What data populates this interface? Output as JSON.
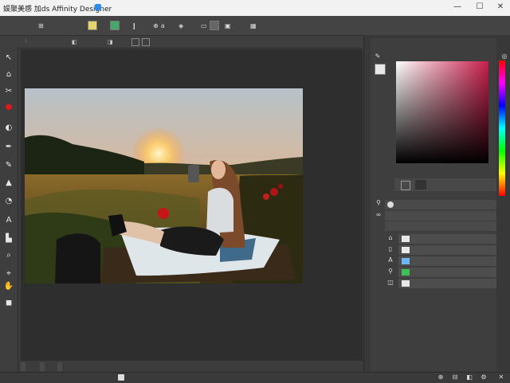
{
  "app": {
    "title": "娱聚美感 加ds Affinity Designer",
    "title_suffix_icon": "app-badge-icon"
  },
  "window_controls": {
    "minimize": "—",
    "maximize": "☐",
    "close": "✕"
  },
  "toolbar": {
    "items": [
      {
        "icon": "",
        "label": ""
      },
      {
        "icon": "⊞",
        "label": ""
      },
      {
        "icon": "",
        "label": ""
      },
      {
        "icon": "⊡",
        "label": ""
      },
      {
        "icon": "❙",
        "label": ""
      },
      {
        "icon": "⊕",
        "label": "a"
      },
      {
        "icon": "◈",
        "label": ""
      },
      {
        "icon": "▭",
        "label": ""
      },
      {
        "icon": "▣",
        "label": ""
      },
      {
        "icon": "▦",
        "label": ""
      }
    ],
    "swatch_yellow": "#e6d36a",
    "swatch_green": "#49a66b",
    "swatch_gray": "#666666"
  },
  "context_bar": {
    "items": [
      {
        "icon": "⫶"
      },
      {
        "label": ""
      },
      {
        "icon": "◧"
      },
      {
        "label": ""
      },
      {
        "icon": "◨"
      },
      {
        "icon": "▢"
      },
      {
        "icon": "▢"
      }
    ]
  },
  "tools": [
    "move-icon",
    "node-icon",
    "crop-icon",
    "record-icon",
    "shape-icon",
    "pen-icon",
    "pencil-icon",
    "vector-brush-icon",
    "fill-icon",
    "text-icon",
    "artboard-icon",
    "eyedropper-icon",
    "zoom-icon",
    "hand-icon",
    "color-icon"
  ],
  "tool_glyphs": [
    "↖",
    "⌂",
    "✂",
    "●",
    "◐",
    "✒",
    "✎",
    "▲",
    "◔",
    "A",
    "▙",
    "⌕",
    "⌖",
    "✋",
    "◼"
  ],
  "canvas_tabs": [
    {
      "label": ""
    },
    {
      "label": ""
    },
    {
      "label": ""
    }
  ],
  "statusbar": {
    "left": "",
    "mid": "",
    "right": ""
  },
  "right_panel": {
    "tab_label": "",
    "color_header": "",
    "color_footer": "",
    "prop_rows": [
      {
        "label": ""
      },
      {
        "label": ""
      },
      {
        "label": ""
      }
    ],
    "layers": [
      {
        "name": "",
        "color": "#e8e8e8"
      },
      {
        "name": "",
        "color": "#e8e8e8"
      },
      {
        "name": "",
        "color": "#6fb6f2"
      },
      {
        "name": "",
        "color": "#3fbf55"
      },
      {
        "name": "",
        "color": "#e8e8e8"
      }
    ]
  },
  "colors": {
    "accent": "#2a8ef0",
    "toolbar_bg": "#444444",
    "panel_bg": "#3e3e3e",
    "canvas_bg": "#2e2e2e"
  }
}
